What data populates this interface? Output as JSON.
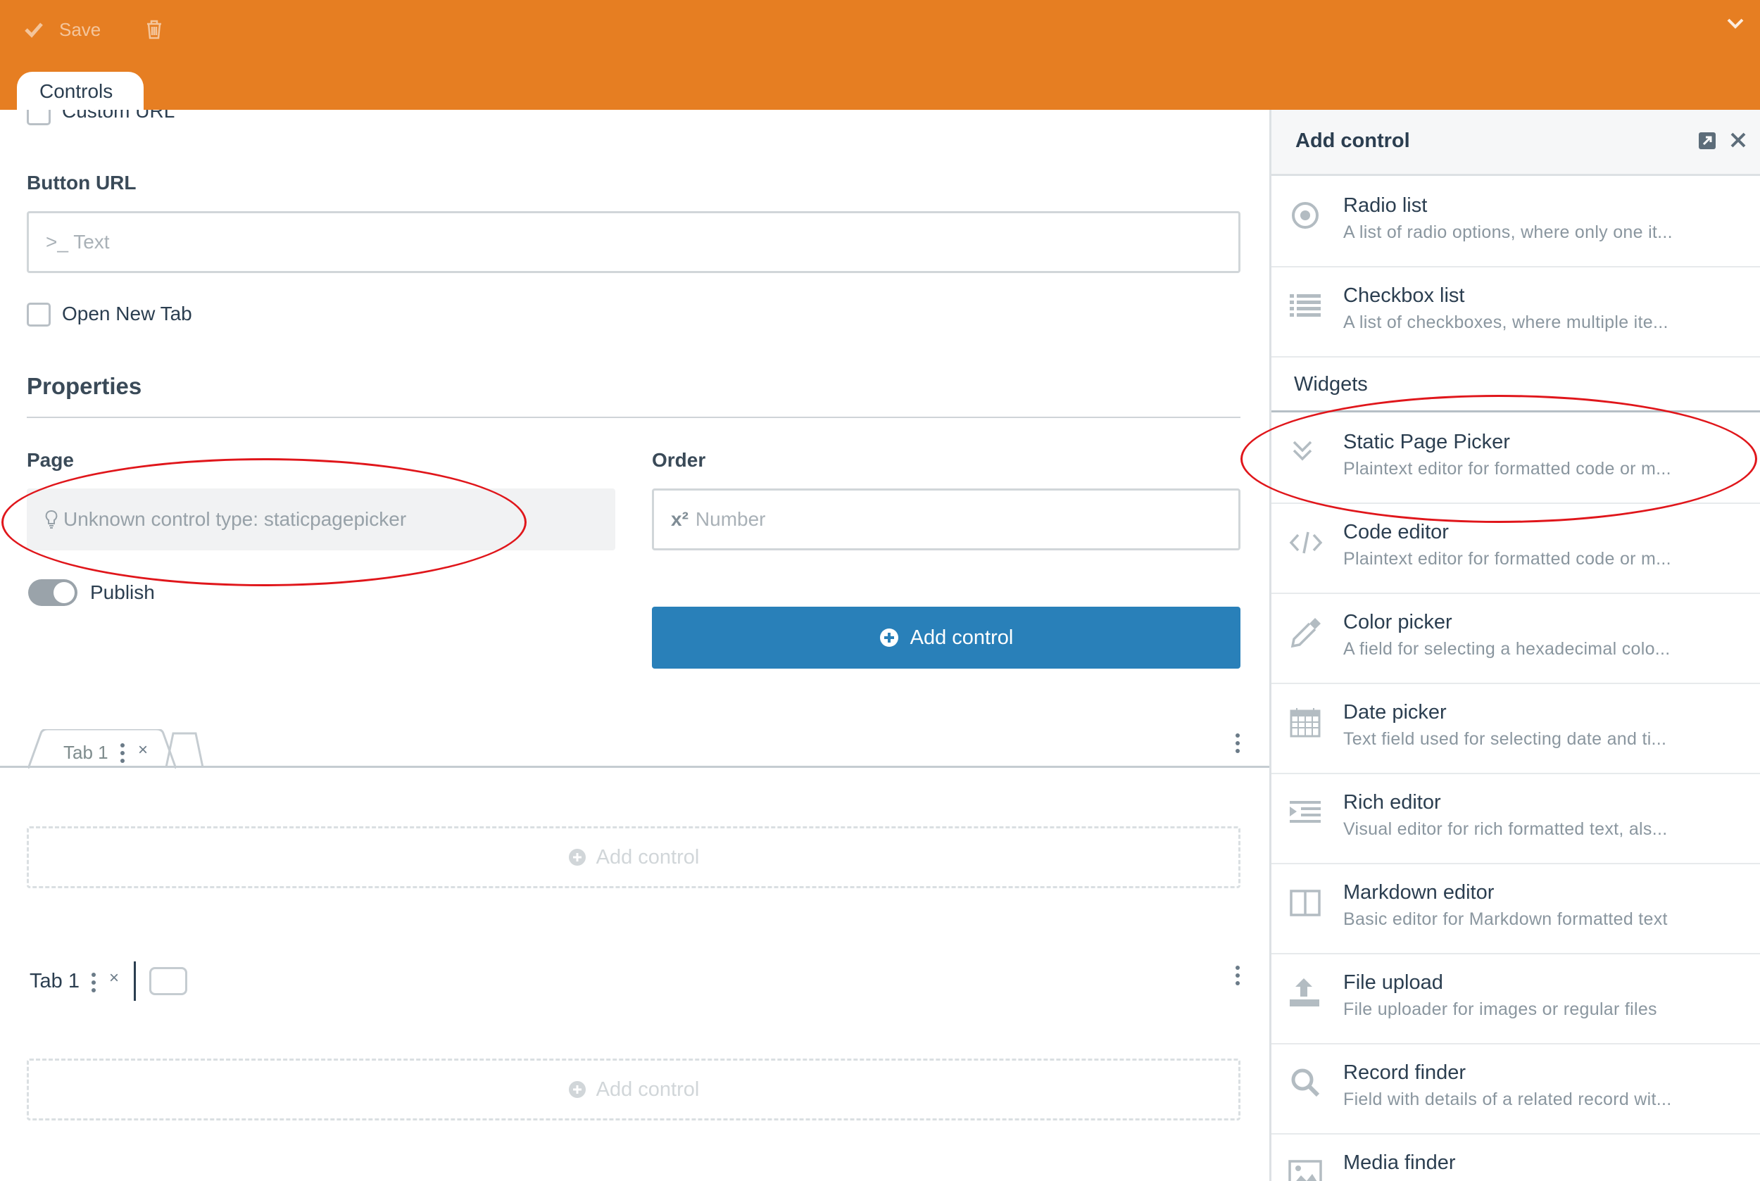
{
  "toolbar": {
    "save_label": "Save"
  },
  "top_tab": {
    "label": "Controls"
  },
  "form": {
    "custom_url_label": "Custom URL",
    "button_url_label": "Button URL",
    "button_url_placeholder": ">_ Text",
    "open_new_tab_label": "Open New Tab",
    "properties_title": "Properties",
    "page_label": "Page",
    "page_unknown": "Unknown control type: staticpagepicker",
    "order_label": "Order",
    "order_placeholder_prefix": "x²",
    "order_placeholder": "Number",
    "publish_label": "Publish",
    "add_control_label": "Add control"
  },
  "tabs_area": {
    "tab1_label": "Tab 1",
    "tab2_label": "Tab 1",
    "close_symbol": "×",
    "placeholder_add_1": "Add control",
    "placeholder_add_2": "Add control"
  },
  "panel": {
    "title": "Add control",
    "widgets_header": "Widgets",
    "items_top": [
      {
        "title": "Radio list",
        "desc": "A list of radio options, where only one it...",
        "icon": "radio-icon"
      },
      {
        "title": "Checkbox list",
        "desc": "A list of checkboxes, where multiple ite...",
        "icon": "list-icon"
      }
    ],
    "items": [
      {
        "title": "Static Page Picker",
        "desc": "Plaintext editor for formatted code or m...",
        "icon": "chevrons-down-icon"
      },
      {
        "title": "Code editor",
        "desc": "Plaintext editor for formatted code or m...",
        "icon": "code-icon"
      },
      {
        "title": "Color picker",
        "desc": "A field for selecting a hexadecimal colo...",
        "icon": "eyedropper-icon"
      },
      {
        "title": "Date picker",
        "desc": "Text field used for selecting date and ti...",
        "icon": "calendar-icon"
      },
      {
        "title": "Rich editor",
        "desc": "Visual editor for rich formatted text, als...",
        "icon": "indent-icon"
      },
      {
        "title": "Markdown editor",
        "desc": "Basic editor for Markdown formatted text",
        "icon": "columns-icon"
      },
      {
        "title": "File upload",
        "desc": "File uploader for images or regular files",
        "icon": "upload-icon"
      },
      {
        "title": "Record finder",
        "desc": "Field with details of a related record wit...",
        "icon": "search-icon"
      },
      {
        "title": "Media finder",
        "desc": "",
        "icon": "image-icon"
      }
    ]
  },
  "colors": {
    "toolbar": "#e67e22",
    "primary": "#2980b9",
    "annotation": "#e0161b"
  }
}
